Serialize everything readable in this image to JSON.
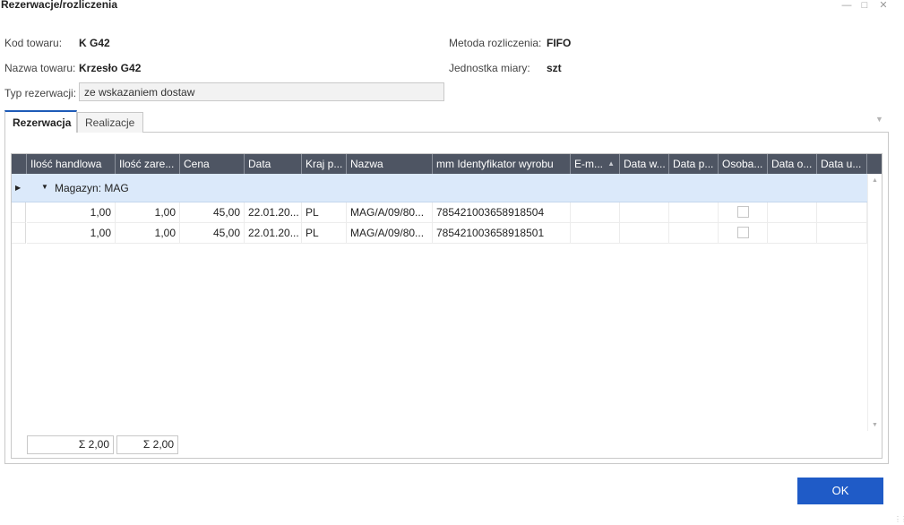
{
  "window": {
    "title": "Rezerwacje/rozliczenia",
    "minimize_icon": "minimize-icon",
    "maximize_icon": "maximize-icon",
    "close_icon": "close-icon"
  },
  "fields": {
    "kod_label": "Kod towaru:",
    "kod_value": "K G42",
    "nazwa_label": "Nazwa towaru:",
    "nazwa_value": "Krzesło G42",
    "typ_label": "Typ rezerwacji:",
    "typ_value": "ze wskazaniem dostaw",
    "metoda_label": "Metoda rozliczenia:",
    "metoda_value": "FIFO",
    "jednostka_label": "Jednostka miary:",
    "jednostka_value": "szt"
  },
  "tabs": [
    {
      "label": "Rezerwacja",
      "active": true
    },
    {
      "label": "Realizacje",
      "active": false
    }
  ],
  "grid": {
    "columns": [
      "Ilość handlowa",
      "Ilość zare...",
      "Cena",
      "Data",
      "Kraj p...",
      "Nazwa",
      "mm Identyfikator wyrobu",
      "E-m...",
      "Data w...",
      "Data p...",
      "Osoba...",
      "Data o...",
      "Data u..."
    ],
    "sorted_column": "E-m...",
    "group_label": "Magazyn: MAG",
    "rows": [
      {
        "ilosc": "1,00",
        "ilosc_zar": "1,00",
        "cena": "45,00",
        "data": "22.01.20...",
        "kraj": "PL",
        "nazwa": "MAG/A/09/80...",
        "identyfikator": "785421003658918504",
        "osoba_checked": false
      },
      {
        "ilosc": "1,00",
        "ilosc_zar": "1,00",
        "cena": "45,00",
        "data": "22.01.20...",
        "kraj": "PL",
        "nazwa": "MAG/A/09/80...",
        "identyfikator": "785421003658918501",
        "osoba_checked": false
      }
    ],
    "footer": {
      "sum_ilosc": "Σ  2,00",
      "sum_ilosc_zar": "Σ  2,00"
    }
  },
  "buttons": {
    "ok": "OK"
  },
  "colors": {
    "header_bg": "#4e5563",
    "group_bg": "#dbe9fa",
    "accent": "#1f5bc7"
  }
}
